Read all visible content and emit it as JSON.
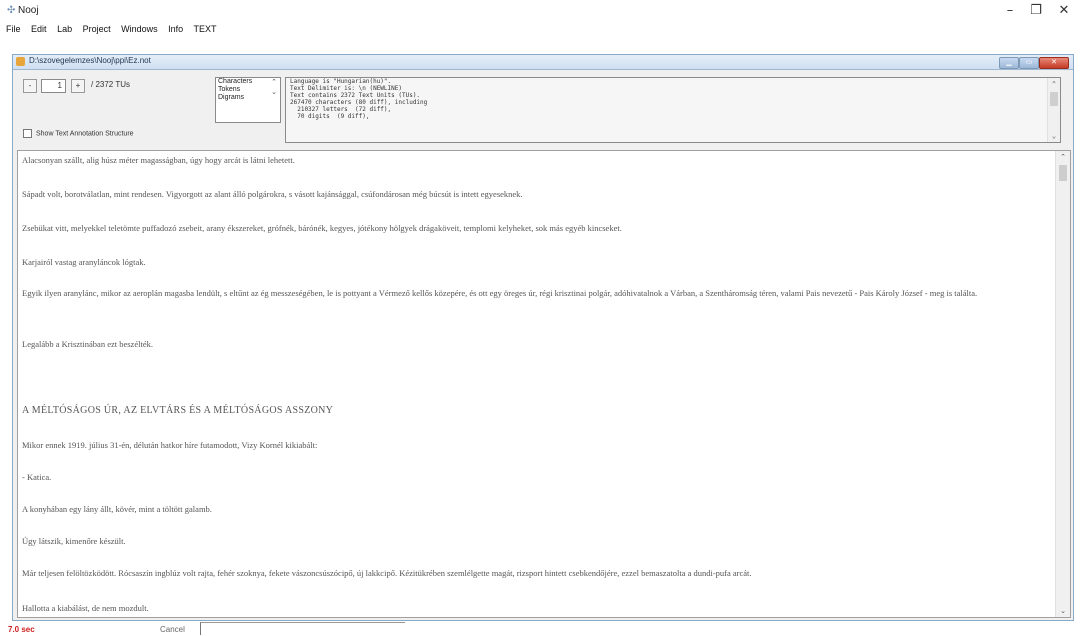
{
  "app": {
    "title": "Nooj",
    "menu": [
      "File",
      "Edit",
      "Lab",
      "Project",
      "Windows",
      "Info",
      "TEXT"
    ],
    "window_controls": {
      "minimize": "–",
      "maximize": "❐",
      "close": "✕"
    }
  },
  "child_window": {
    "title": "D:\\szovegelemzes\\Nooj\\ppi\\Ez.not"
  },
  "toolbar": {
    "prev_button": "-",
    "current_tu": "1",
    "next_button": "+",
    "tu_count": "/ 2372 TUs",
    "show_annotation_label": "Show Text Annotation Structure",
    "view_options": [
      "Characters",
      "Tokens",
      "Digrams"
    ]
  },
  "info_lines": [
    "Language is \"Hungarian(hu)\".",
    "Text Delimiter is: \\n (NEWLINE)",
    "Text contains 2372 Text Units (TUs).",
    "267470 characters (80 diff), including",
    "  210327 letters  (72 diff),",
    "  70 digits  (9 diff),"
  ],
  "text": {
    "paragraphs": [
      "Alacsonyan szállt, alig húsz méter magasságban, úgy hogy arcát is látni lehetett.",
      "Sápadt volt, borotválatlan, mint rendesen. Vigyorgott az alant álló polgárokra, s vásott kajánsággal, csúfondárosan még búcsút is intett egyeseknek.",
      "Zsebükat vitt, melyekkel teletömte puffadozó zsebeit, arany ékszereket, grófnék, bárónék, kegyes, jótékony hölgyek drágaköveit, templomi kelyheket, sok más egyéb kincseket.",
      "Karjairól vastag aranyláncok lógtak.",
      "Egyik ilyen aranylánc, mikor az aeroplán magasba lendült, s eltűnt az ég messzeségében, le is pottyant a Vérmező kellős közepére, és ott egy öreges úr, régi krisztinai polgár, adóhivatalnok a Várban, a Szentháromság téren, valami Pais nevezetű - Pais Károly József - meg is találta.",
      "Legalább a Krisztinában ezt beszélték.",
      "A MÉLTÓSÁGOS ÚR, AZ ELVTÁRS ÉS A MÉLTÓSÁGOS ASSZONY",
      "Mikor ennek 1919. július 31-én, délután hatkor híre futamodott, Vizy Kornél kikiabált:",
      "- Katica.",
      "A konyhában egy lány állt, kövér, mint a töltött galamb.",
      "Úgy látszik, kimenőre készült.",
      "Már teljesen felöltözködött. Rócsaszín ingblúz volt rajta, fehér szoknya, fekete vászoncsúszócipő, új lakkcipő. Kézitükrében szemlélgette magát, rizsport hintett csebkendőjére, ezzel bemaszatolta a dundi-pufa arcát.",
      "Hallotta a kiabálást, de nem mozdult."
    ]
  },
  "status": {
    "time": "7.0 sec",
    "cancel": "Cancel"
  }
}
